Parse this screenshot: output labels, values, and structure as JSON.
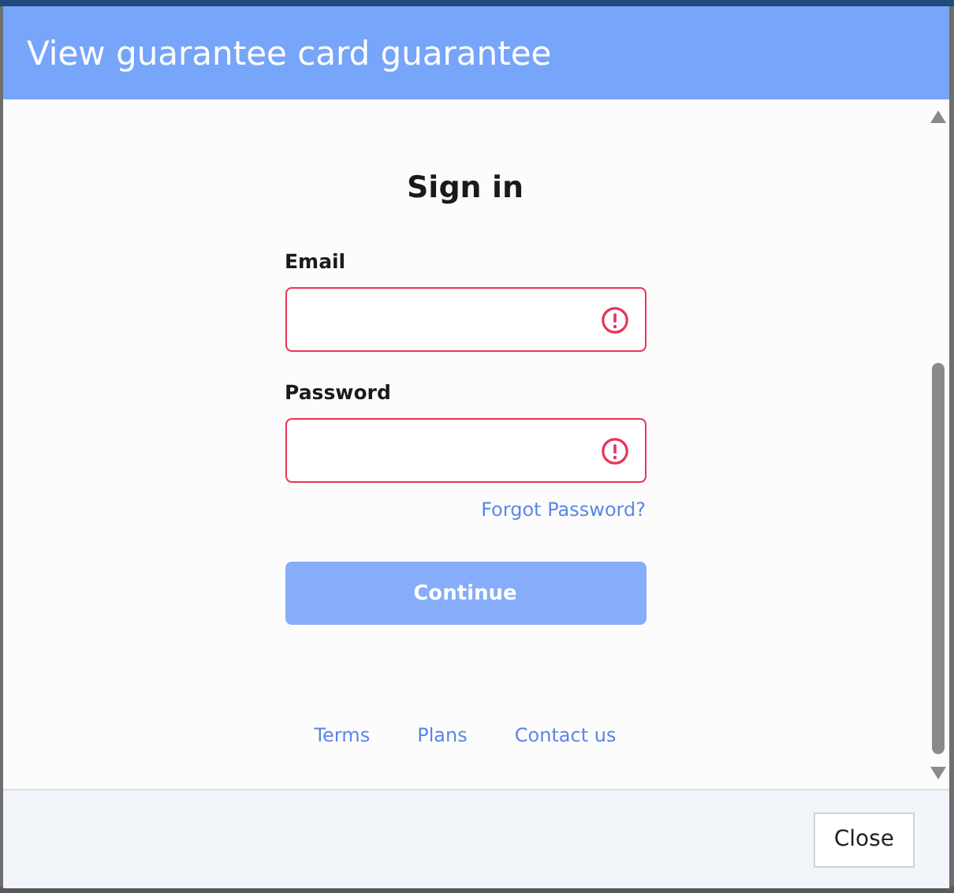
{
  "dialog": {
    "title": "View guarantee card guarantee"
  },
  "form": {
    "heading": "Sign in",
    "fields": [
      {
        "label": "Email",
        "invalid": true
      },
      {
        "label": "Password",
        "invalid": true
      }
    ],
    "forgot_link": "Forgot Password?",
    "submit": {
      "label": "Continue",
      "disabled": true
    },
    "links": [
      "Terms",
      "Plans",
      "Contact us"
    ]
  },
  "footer": {
    "buttons": [
      "Close"
    ]
  }
}
